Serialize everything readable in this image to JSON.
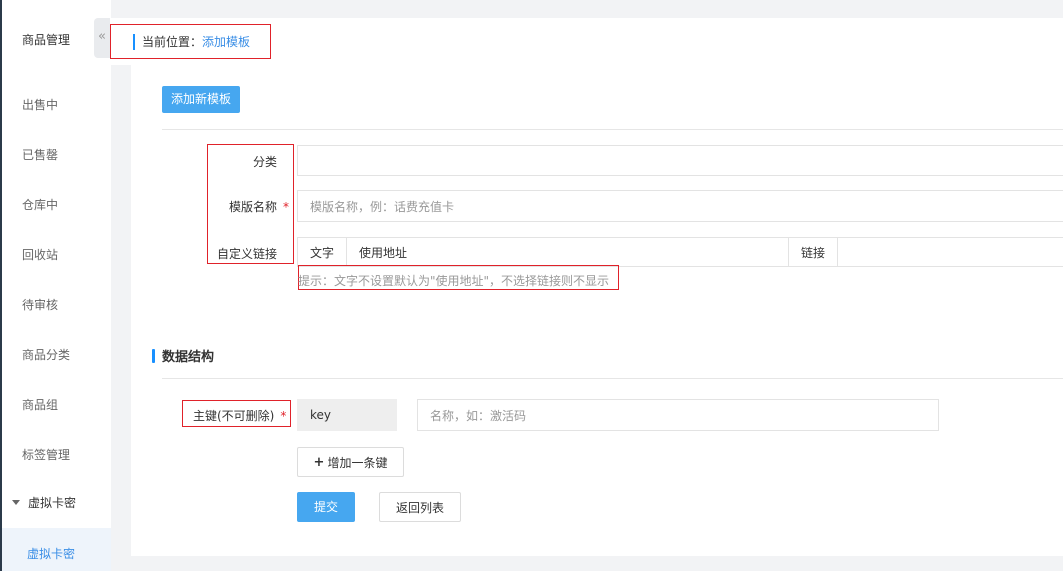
{
  "sidebar": {
    "title": "商品管理",
    "items": [
      "出售中",
      "已售罄",
      "仓库中",
      "回收站",
      "待审核",
      "商品分类",
      "商品组",
      "标签管理"
    ],
    "group": "虚拟卡密",
    "active_item": "虚拟卡密",
    "collapse_glyph": "«"
  },
  "breadcrumb": {
    "prefix": "当前位置：",
    "current": "添加模板"
  },
  "toolbar": {
    "add_template_label": "添加新模板"
  },
  "form": {
    "category_label": "分类",
    "category_value": "",
    "template_name_label": "模版名称",
    "required_mark": "*",
    "template_name_placeholder": "模版名称，例：话费充值卡",
    "custom_link_label": "自定义链接",
    "link_table": {
      "text_label": "文字",
      "text_value": "使用地址",
      "link_label": "链接"
    },
    "hint": "提示：文字不设置默认为\"使用地址\"，不选择链接则不显示"
  },
  "data_structure": {
    "title": "数据结构",
    "primary_key_label": "主键(不可删除)",
    "key_value": "key",
    "name_placeholder": "名称，如：激活码",
    "add_key_label": "增加一条键",
    "add_key_icon": "+"
  },
  "actions": {
    "submit_label": "提交",
    "back_label": "返回列表"
  },
  "colors": {
    "primary": "#46a7f0",
    "accent_blue": "#1890ff",
    "link_blue": "#3a8ee6",
    "annotation_red": "#e0222a"
  }
}
